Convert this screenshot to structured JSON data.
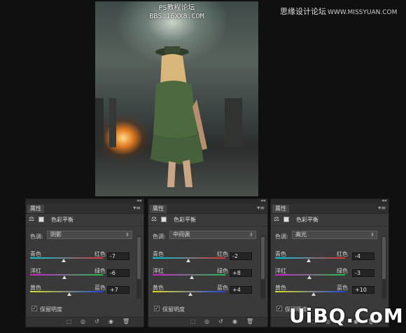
{
  "artwork": {
    "watermark_line1": "PS教程论坛",
    "watermark_line2": "BBS.16XX8.COM"
  },
  "top_watermark": {
    "text": "思缘设计论坛",
    "url": "WWW.MISSYUAN.COM"
  },
  "bottom_watermark": "UiBQ.CoM",
  "panels": [
    {
      "tab_label": "属性",
      "title": "色彩平衡",
      "tone_label": "色调:",
      "tone_value": "阴影",
      "rows": [
        {
          "left": "青色",
          "right": "红色",
          "value": "-7",
          "position": -7
        },
        {
          "left": "洋红",
          "right": "绿色",
          "value": "-6",
          "position": -6
        },
        {
          "left": "黄色",
          "right": "蓝色",
          "value": "+7",
          "position": 7
        }
      ],
      "preserve_luminosity_label": "保留明度",
      "preserve_luminosity_checked": true
    },
    {
      "tab_label": "属性",
      "title": "色彩平衡",
      "tone_label": "色调:",
      "tone_value": "中间调",
      "rows": [
        {
          "left": "青色",
          "right": "红色",
          "value": "-2",
          "position": -2
        },
        {
          "left": "洋红",
          "right": "绿色",
          "value": "+8",
          "position": 8
        },
        {
          "left": "黄色",
          "right": "蓝色",
          "value": "+4",
          "position": 4
        }
      ],
      "preserve_luminosity_label": "保留明度",
      "preserve_luminosity_checked": true
    },
    {
      "tab_label": "属性",
      "title": "色彩平衡",
      "tone_label": "色调:",
      "tone_value": "高光",
      "rows": [
        {
          "left": "青色",
          "right": "红色",
          "value": "-4",
          "position": -4
        },
        {
          "left": "洋红",
          "right": "绿色",
          "value": "-3",
          "position": -3
        },
        {
          "left": "黄色",
          "right": "蓝色",
          "value": "+10",
          "position": 10
        }
      ],
      "preserve_luminosity_label": "保留明度",
      "preserve_luminosity_checked": true
    }
  ],
  "colors": {
    "cyan_red": [
      "#00c8e0",
      "#e03030"
    ],
    "magenta_green": [
      "#d020d0",
      "#20c040"
    ],
    "yellow_blue": [
      "#e0e020",
      "#2040e0"
    ]
  }
}
